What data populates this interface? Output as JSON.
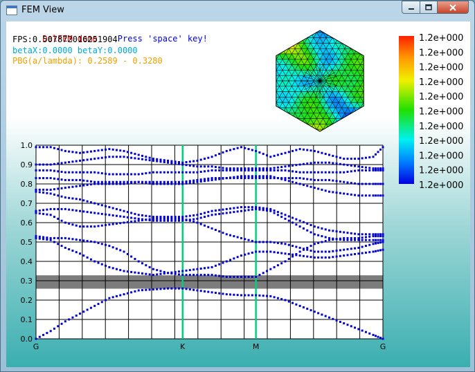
{
  "window": {
    "title": "FEM View"
  },
  "hud": {
    "demo_label": "DelFEM demo",
    "press_hint": "Press 'space' key!",
    "fps": "FPS:0.507872016251904",
    "beta": "betaX:0.0000 betaY:0.0000",
    "pbg": "PBG(a/lambda): 0.2589 - 0.3280",
    "colors": {
      "demo": "#e00000",
      "hint": "#0000e0",
      "fps": "#000000",
      "beta": "#00a8d8",
      "pbg": "#f0a000"
    }
  },
  "colorbar": {
    "labels": [
      "1.2e+000",
      "1.2e+000",
      "1.2e+000",
      "1.2e+000",
      "1.2e+000",
      "1.2e+000",
      "1.2e+000",
      "1.2e+000",
      "1.2e+000",
      "1.2e+000",
      "1.2e+000"
    ]
  },
  "chart_data": {
    "type": "scatter",
    "title": "",
    "xlabel": "",
    "ylabel": "",
    "ylim": [
      0,
      1.0
    ],
    "y_ticks": [
      "0.0",
      "0.1",
      "0.2",
      "0.3",
      "0.4",
      "0.5",
      "0.6",
      "0.7",
      "0.8",
      "0.9",
      "1.0"
    ],
    "x_labels": [
      "G",
      "K",
      "M",
      "G"
    ],
    "x_label_positions": [
      0,
      1,
      1.5,
      2.366
    ],
    "band_gap": [
      0.2589,
      0.328
    ],
    "grid": true,
    "series_color": "#0000d0",
    "marker_color_highlight": "#00d080",
    "bands": [
      {
        "name": "band1",
        "points": [
          [
            0.0,
            0.0
          ],
          [
            0.1,
            0.04
          ],
          [
            0.2,
            0.09
          ],
          [
            0.3,
            0.13
          ],
          [
            0.4,
            0.17
          ],
          [
            0.5,
            0.21
          ],
          [
            0.6,
            0.23
          ],
          [
            0.7,
            0.25
          ],
          [
            0.8,
            0.255
          ],
          [
            0.9,
            0.26
          ],
          [
            1.0,
            0.26
          ],
          [
            1.1,
            0.25
          ],
          [
            1.2,
            0.24
          ],
          [
            1.3,
            0.23
          ],
          [
            1.4,
            0.225
          ],
          [
            1.5,
            0.225
          ],
          [
            1.6,
            0.22
          ],
          [
            1.7,
            0.2
          ],
          [
            1.8,
            0.17
          ],
          [
            1.9,
            0.14
          ],
          [
            2.0,
            0.11
          ],
          [
            2.1,
            0.08
          ],
          [
            2.2,
            0.05
          ],
          [
            2.3,
            0.02
          ],
          [
            2.366,
            0.0
          ]
        ]
      },
      {
        "name": "band2",
        "points": [
          [
            0.0,
            0.52
          ],
          [
            0.1,
            0.51
          ],
          [
            0.2,
            0.47
          ],
          [
            0.3,
            0.44
          ],
          [
            0.4,
            0.4
          ],
          [
            0.5,
            0.37
          ],
          [
            0.6,
            0.35
          ],
          [
            0.7,
            0.34
          ],
          [
            0.8,
            0.33
          ],
          [
            0.9,
            0.34
          ],
          [
            1.0,
            0.35
          ],
          [
            1.1,
            0.36
          ],
          [
            1.2,
            0.37
          ],
          [
            1.3,
            0.4
          ],
          [
            1.4,
            0.43
          ],
          [
            1.5,
            0.45
          ],
          [
            1.6,
            0.45
          ],
          [
            1.7,
            0.44
          ],
          [
            1.8,
            0.43
          ],
          [
            1.9,
            0.42
          ],
          [
            2.0,
            0.42
          ],
          [
            2.1,
            0.43
          ],
          [
            2.2,
            0.44
          ],
          [
            2.3,
            0.45
          ],
          [
            2.366,
            0.46
          ]
        ]
      },
      {
        "name": "band3",
        "points": [
          [
            0.0,
            0.53
          ],
          [
            0.1,
            0.52
          ],
          [
            0.2,
            0.52
          ],
          [
            0.3,
            0.51
          ],
          [
            0.4,
            0.5
          ],
          [
            0.5,
            0.48
          ],
          [
            0.6,
            0.45
          ],
          [
            0.7,
            0.4
          ],
          [
            0.8,
            0.36
          ],
          [
            0.9,
            0.34
          ],
          [
            1.0,
            0.33
          ],
          [
            1.1,
            0.33
          ],
          [
            1.2,
            0.33
          ],
          [
            1.3,
            0.32
          ],
          [
            1.4,
            0.32
          ],
          [
            1.5,
            0.32
          ],
          [
            1.6,
            0.36
          ],
          [
            1.7,
            0.4
          ],
          [
            1.8,
            0.45
          ],
          [
            1.9,
            0.49
          ],
          [
            2.0,
            0.51
          ],
          [
            2.1,
            0.52
          ],
          [
            2.2,
            0.52
          ],
          [
            2.3,
            0.53
          ],
          [
            2.366,
            0.53
          ]
        ]
      },
      {
        "name": "band4",
        "points": [
          [
            0.0,
            0.65
          ],
          [
            0.1,
            0.64
          ],
          [
            0.2,
            0.6
          ],
          [
            0.3,
            0.58
          ],
          [
            0.4,
            0.58
          ],
          [
            0.5,
            0.59
          ],
          [
            0.6,
            0.6
          ],
          [
            0.7,
            0.61
          ],
          [
            0.8,
            0.62
          ],
          [
            0.9,
            0.62
          ],
          [
            1.0,
            0.62
          ],
          [
            1.1,
            0.6
          ],
          [
            1.2,
            0.57
          ],
          [
            1.3,
            0.54
          ],
          [
            1.4,
            0.52
          ],
          [
            1.5,
            0.5
          ],
          [
            1.6,
            0.5
          ],
          [
            1.7,
            0.49
          ],
          [
            1.8,
            0.47
          ],
          [
            1.9,
            0.45
          ],
          [
            2.0,
            0.45
          ],
          [
            2.1,
            0.46
          ],
          [
            2.2,
            0.47
          ],
          [
            2.3,
            0.49
          ],
          [
            2.366,
            0.5
          ]
        ]
      },
      {
        "name": "band5",
        "points": [
          [
            0.0,
            0.66
          ],
          [
            0.1,
            0.67
          ],
          [
            0.2,
            0.67
          ],
          [
            0.3,
            0.66
          ],
          [
            0.4,
            0.65
          ],
          [
            0.5,
            0.64
          ],
          [
            0.6,
            0.63
          ],
          [
            0.7,
            0.62
          ],
          [
            0.8,
            0.61
          ],
          [
            0.9,
            0.61
          ],
          [
            1.0,
            0.61
          ],
          [
            1.1,
            0.62
          ],
          [
            1.2,
            0.64
          ],
          [
            1.3,
            0.65
          ],
          [
            1.4,
            0.66
          ],
          [
            1.5,
            0.67
          ],
          [
            1.6,
            0.66
          ],
          [
            1.7,
            0.62
          ],
          [
            1.8,
            0.58
          ],
          [
            1.9,
            0.54
          ],
          [
            2.0,
            0.52
          ],
          [
            2.1,
            0.51
          ],
          [
            2.2,
            0.51
          ],
          [
            2.3,
            0.51
          ],
          [
            2.366,
            0.51
          ]
        ]
      },
      {
        "name": "band6",
        "points": [
          [
            0.0,
            0.76
          ],
          [
            0.1,
            0.75
          ],
          [
            0.2,
            0.73
          ],
          [
            0.3,
            0.72
          ],
          [
            0.4,
            0.7
          ],
          [
            0.5,
            0.68
          ],
          [
            0.6,
            0.66
          ],
          [
            0.7,
            0.64
          ],
          [
            0.8,
            0.63
          ],
          [
            0.9,
            0.63
          ],
          [
            1.0,
            0.63
          ],
          [
            1.1,
            0.64
          ],
          [
            1.2,
            0.66
          ],
          [
            1.3,
            0.67
          ],
          [
            1.4,
            0.68
          ],
          [
            1.5,
            0.68
          ],
          [
            1.6,
            0.67
          ],
          [
            1.7,
            0.64
          ],
          [
            1.8,
            0.61
          ],
          [
            1.9,
            0.58
          ],
          [
            2.0,
            0.56
          ],
          [
            2.1,
            0.55
          ],
          [
            2.2,
            0.54
          ],
          [
            2.3,
            0.54
          ],
          [
            2.366,
            0.54
          ]
        ]
      },
      {
        "name": "band7",
        "points": [
          [
            0.0,
            0.77
          ],
          [
            0.1,
            0.77
          ],
          [
            0.2,
            0.78
          ],
          [
            0.3,
            0.79
          ],
          [
            0.4,
            0.8
          ],
          [
            0.5,
            0.8
          ],
          [
            0.6,
            0.8
          ],
          [
            0.7,
            0.81
          ],
          [
            0.8,
            0.81
          ],
          [
            0.9,
            0.81
          ],
          [
            1.0,
            0.81
          ],
          [
            1.1,
            0.82
          ],
          [
            1.2,
            0.83
          ],
          [
            1.3,
            0.83
          ],
          [
            1.4,
            0.84
          ],
          [
            1.5,
            0.84
          ],
          [
            1.6,
            0.84
          ],
          [
            1.7,
            0.82
          ],
          [
            1.8,
            0.8
          ],
          [
            1.9,
            0.78
          ],
          [
            2.0,
            0.76
          ],
          [
            2.1,
            0.75
          ],
          [
            2.2,
            0.74
          ],
          [
            2.3,
            0.74
          ],
          [
            2.366,
            0.74
          ]
        ]
      },
      {
        "name": "band8",
        "points": [
          [
            0.0,
            0.83
          ],
          [
            0.1,
            0.83
          ],
          [
            0.2,
            0.82
          ],
          [
            0.3,
            0.82
          ],
          [
            0.4,
            0.81
          ],
          [
            0.5,
            0.81
          ],
          [
            0.6,
            0.81
          ],
          [
            0.7,
            0.81
          ],
          [
            0.8,
            0.8
          ],
          [
            0.9,
            0.8
          ],
          [
            1.0,
            0.8
          ],
          [
            1.1,
            0.81
          ],
          [
            1.2,
            0.82
          ],
          [
            1.3,
            0.83
          ],
          [
            1.4,
            0.83
          ],
          [
            1.5,
            0.83
          ],
          [
            1.6,
            0.83
          ],
          [
            1.7,
            0.83
          ],
          [
            1.8,
            0.83
          ],
          [
            1.9,
            0.82
          ],
          [
            2.0,
            0.82
          ],
          [
            2.1,
            0.81
          ],
          [
            2.2,
            0.8
          ],
          [
            2.3,
            0.8
          ],
          [
            2.366,
            0.8
          ]
        ]
      },
      {
        "name": "band9",
        "points": [
          [
            0.0,
            0.87
          ],
          [
            0.1,
            0.87
          ],
          [
            0.2,
            0.86
          ],
          [
            0.3,
            0.86
          ],
          [
            0.4,
            0.86
          ],
          [
            0.5,
            0.85
          ],
          [
            0.6,
            0.85
          ],
          [
            0.7,
            0.85
          ],
          [
            0.8,
            0.86
          ],
          [
            0.9,
            0.86
          ],
          [
            1.0,
            0.86
          ],
          [
            1.1,
            0.86
          ],
          [
            1.2,
            0.87
          ],
          [
            1.3,
            0.87
          ],
          [
            1.4,
            0.87
          ],
          [
            1.5,
            0.87
          ],
          [
            1.6,
            0.87
          ],
          [
            1.7,
            0.87
          ],
          [
            1.8,
            0.86
          ],
          [
            1.9,
            0.86
          ],
          [
            2.0,
            0.86
          ],
          [
            2.1,
            0.86
          ],
          [
            2.2,
            0.87
          ],
          [
            2.3,
            0.87
          ],
          [
            2.366,
            0.87
          ]
        ]
      },
      {
        "name": "band10",
        "points": [
          [
            0.0,
            0.9
          ],
          [
            0.1,
            0.9
          ],
          [
            0.2,
            0.91
          ],
          [
            0.3,
            0.92
          ],
          [
            0.4,
            0.93
          ],
          [
            0.5,
            0.94
          ],
          [
            0.6,
            0.94
          ],
          [
            0.7,
            0.93
          ],
          [
            0.8,
            0.92
          ],
          [
            0.9,
            0.91
          ],
          [
            1.0,
            0.9
          ],
          [
            1.1,
            0.89
          ],
          [
            1.2,
            0.89
          ],
          [
            1.3,
            0.88
          ],
          [
            1.4,
            0.88
          ],
          [
            1.5,
            0.88
          ],
          [
            1.6,
            0.88
          ],
          [
            1.7,
            0.89
          ],
          [
            1.8,
            0.9
          ],
          [
            1.9,
            0.91
          ],
          [
            2.0,
            0.91
          ],
          [
            2.1,
            0.9
          ],
          [
            2.2,
            0.89
          ],
          [
            2.3,
            0.88
          ],
          [
            2.366,
            0.88
          ]
        ]
      },
      {
        "name": "band11",
        "points": [
          [
            0.0,
            0.99
          ],
          [
            0.1,
            0.99
          ],
          [
            0.2,
            0.97
          ],
          [
            0.3,
            0.96
          ],
          [
            0.4,
            0.97
          ],
          [
            0.5,
            0.98
          ],
          [
            0.6,
            0.97
          ],
          [
            0.7,
            0.95
          ],
          [
            0.8,
            0.93
          ],
          [
            0.9,
            0.92
          ],
          [
            1.0,
            0.91
          ],
          [
            1.1,
            0.92
          ],
          [
            1.2,
            0.94
          ],
          [
            1.3,
            0.97
          ],
          [
            1.4,
            0.99
          ],
          [
            1.5,
            0.97
          ],
          [
            1.6,
            0.94
          ],
          [
            1.7,
            0.96
          ],
          [
            1.8,
            0.98
          ],
          [
            1.9,
            0.97
          ],
          [
            2.0,
            0.95
          ],
          [
            2.1,
            0.93
          ],
          [
            2.2,
            0.93
          ],
          [
            2.3,
            0.94
          ],
          [
            2.366,
            0.99
          ]
        ]
      }
    ]
  }
}
